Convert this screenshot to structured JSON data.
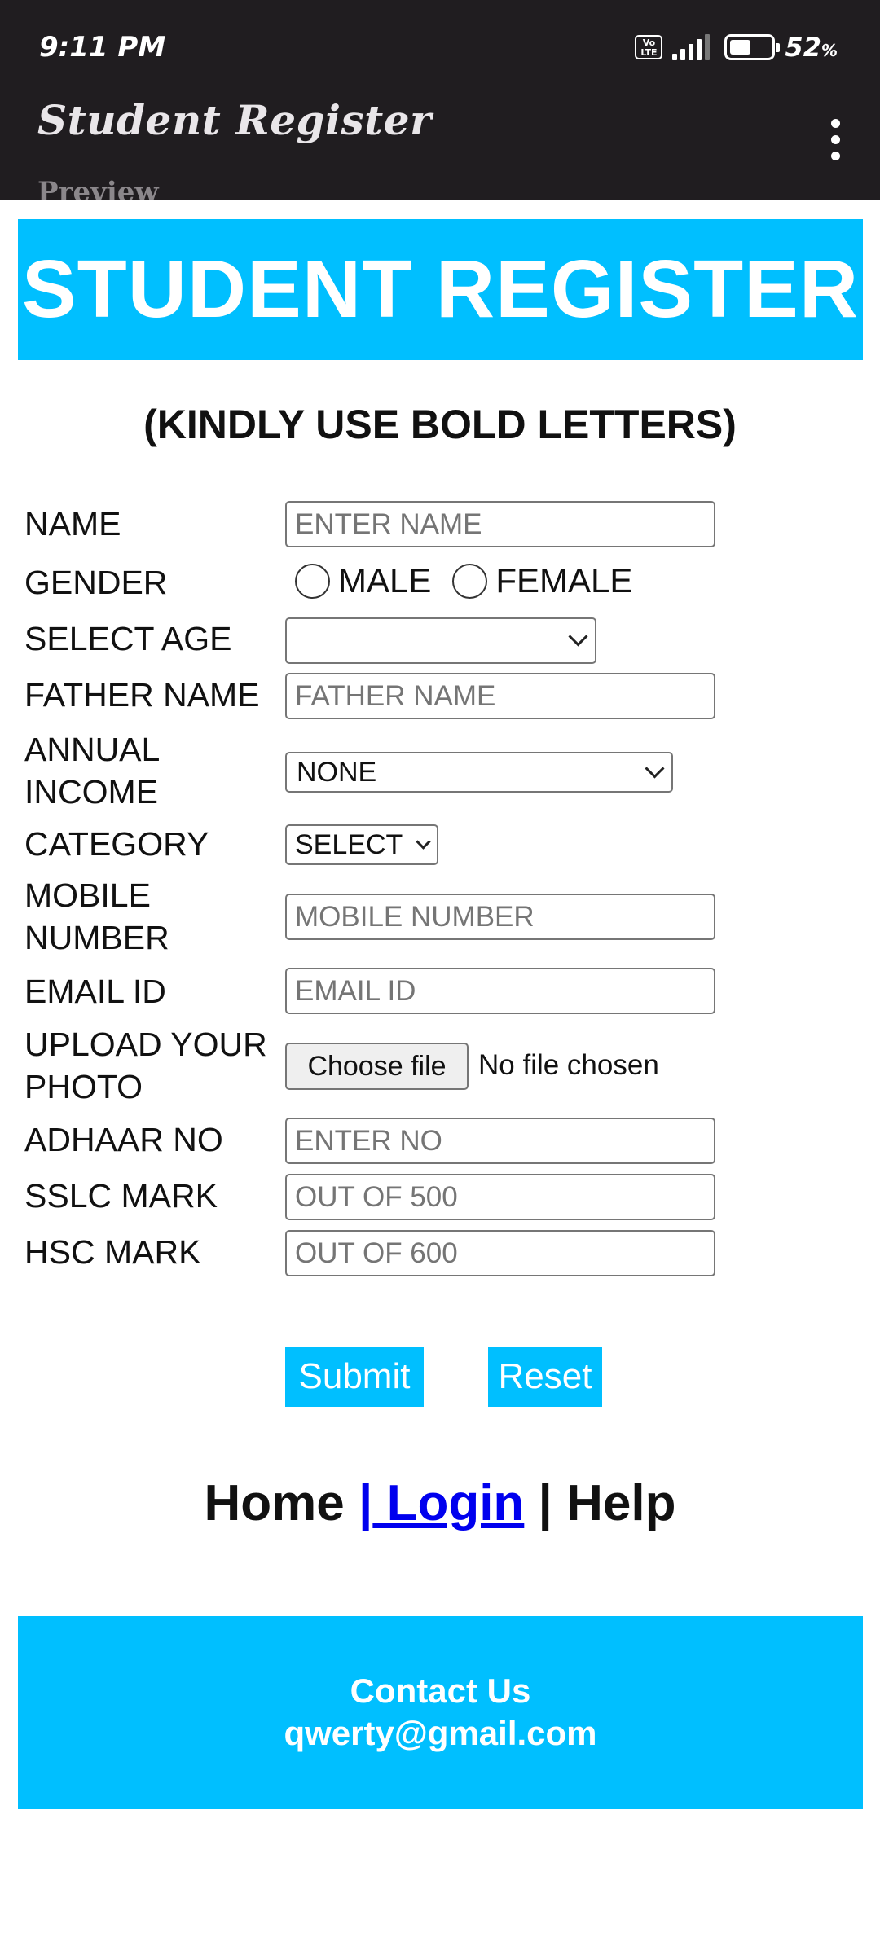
{
  "status_bar": {
    "time": "9:11 PM",
    "volte": "Vo LTE",
    "battery_percent": "52",
    "battery_unit": "%",
    "battery_level": 0.52,
    "signal_bars": 4
  },
  "app_bar": {
    "title": "Student Register",
    "subtitle": "Preview",
    "menu_icon": "more-vert-icon"
  },
  "banner": {
    "title": "STUDENT REGISTER"
  },
  "note": "(KINDLY USE BOLD LETTERS)",
  "form": {
    "name": {
      "label": "NAME",
      "placeholder": "ENTER NAME",
      "value": ""
    },
    "gender": {
      "label": "GENDER",
      "options": [
        "MALE",
        "FEMALE"
      ],
      "selected": null
    },
    "age": {
      "label": "SELECT AGE",
      "value": ""
    },
    "father_name": {
      "label": "FATHER NAME",
      "placeholder": "FATHER NAME",
      "value": ""
    },
    "income": {
      "label_line1": "ANNUAL",
      "label_line2": "INCOME",
      "value": "NONE"
    },
    "category": {
      "label": "CATEGORY",
      "value": "SELECT"
    },
    "mobile": {
      "label_line1": "MOBILE",
      "label_line2": "NUMBER",
      "placeholder": "MOBILE NUMBER",
      "value": ""
    },
    "email": {
      "label": "EMAIL ID",
      "placeholder": "EMAIL ID",
      "value": ""
    },
    "photo": {
      "label_line1": "UPLOAD YOUR",
      "label_line2": "PHOTO",
      "button": "Choose file",
      "status": "No file chosen"
    },
    "adhaar": {
      "label": "ADHAAR NO",
      "placeholder": "ENTER NO",
      "value": ""
    },
    "sslc": {
      "label": "SSLC MARK",
      "placeholder": "OUT OF 500",
      "value": ""
    },
    "hsc": {
      "label": "HSC MARK",
      "placeholder": "OUT OF 600",
      "value": ""
    },
    "submit": "Submit",
    "reset": "Reset"
  },
  "nav": {
    "home": "Home",
    "sep1": "|",
    "login": " Login",
    "sep2": "|",
    "help": "Help"
  },
  "footer": {
    "contact": "Contact Us",
    "email": "qwerty@gmail.com"
  },
  "colors": {
    "accent": "#00bfff",
    "appbar": "#201d20",
    "link": "#0000ee"
  }
}
